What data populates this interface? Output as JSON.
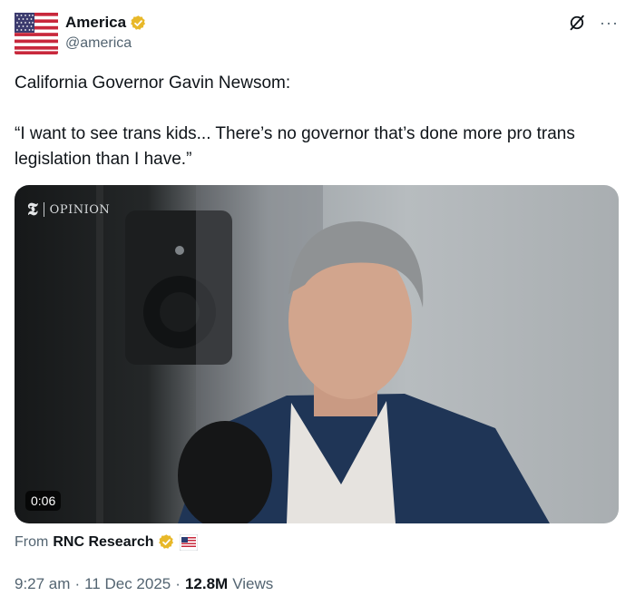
{
  "author": {
    "display_name": "America",
    "handle": "@america",
    "verified": true,
    "avatar_icon": "us-flag-icon",
    "verified_color": "#e8b829"
  },
  "tweet": {
    "text_line1": "California Governor Gavin Newsom:",
    "text_line2": "“I want to see trans kids... There’s no governor that’s done more pro trans legislation than I have.”"
  },
  "media": {
    "watermark_logo": "𝕿",
    "watermark_label": "OPINION",
    "duration": "0:06"
  },
  "attribution": {
    "prefix": "From",
    "source_name": "RNC Research",
    "verified": true
  },
  "meta": {
    "time": "9:27 am",
    "separator1": "·",
    "date": "11 Dec 2025",
    "separator2": "·",
    "views_count": "12.8M",
    "views_label": "Views"
  },
  "icons": {
    "more": "···"
  }
}
